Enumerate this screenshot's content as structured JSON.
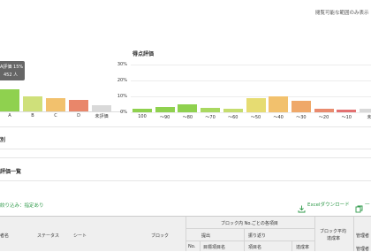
{
  "header": {
    "top_right_text": "閲覧可能な範囲のみ表示"
  },
  "grade_chart": {
    "tooltip_line1": "A評価 15%",
    "tooltip_line2": "452 人",
    "chart_data": {
      "type": "bar",
      "categories": [
        "A",
        "B",
        "C",
        "D",
        "未評価"
      ],
      "values": [
        15,
        10,
        9,
        8,
        4
      ],
      "ylim": [
        0,
        30
      ],
      "colors": [
        "#8fd14f",
        "#cfe07a",
        "#f2c16d",
        "#e9866a",
        "#d9d9d9"
      ]
    }
  },
  "score_chart": {
    "title": "得点評価",
    "chart_data": {
      "type": "bar",
      "categories": [
        "100",
        "〜90",
        "〜80",
        "〜70",
        "〜60",
        "〜50",
        "〜40",
        "〜30",
        "〜20",
        "〜10",
        "未"
      ],
      "values": [
        2,
        3.5,
        5,
        3,
        2,
        9,
        10,
        7,
        2,
        1.5,
        2.5
      ],
      "yticks": [
        "30%",
        "20%",
        "10%",
        "0%"
      ],
      "ylim": [
        0,
        30
      ],
      "colors": [
        "#8fd14f",
        "#8fd14f",
        "#8fd14f",
        "#a9d861",
        "#c5dd6f",
        "#e6dc72",
        "#f2c16d",
        "#efa869",
        "#e98b6e",
        "#e37171",
        "#d9d9d9"
      ]
    }
  },
  "section_breakdown": {
    "title": "別"
  },
  "section_list": {
    "title": "評価一覧"
  },
  "filter": {
    "label": "絞り込み：指定あり"
  },
  "excel": {
    "label": "Excelダウンロード"
  },
  "extra_button": {
    "label": "一"
  },
  "table": {
    "group_header": "ブロック内 No.ごとの各項目",
    "avg_header_line1": "ブロック平均",
    "avg_header_line2": "達成率",
    "admin_header": "管理者",
    "admin_header_2": "管理者",
    "headers": [
      "者名",
      "ステータス",
      "シート",
      "ブロック"
    ],
    "sub_headers": [
      "提出",
      "振り返り"
    ],
    "sub_sub_headers": [
      "No.",
      "目標項目名",
      "項目名",
      "達成率"
    ]
  }
}
